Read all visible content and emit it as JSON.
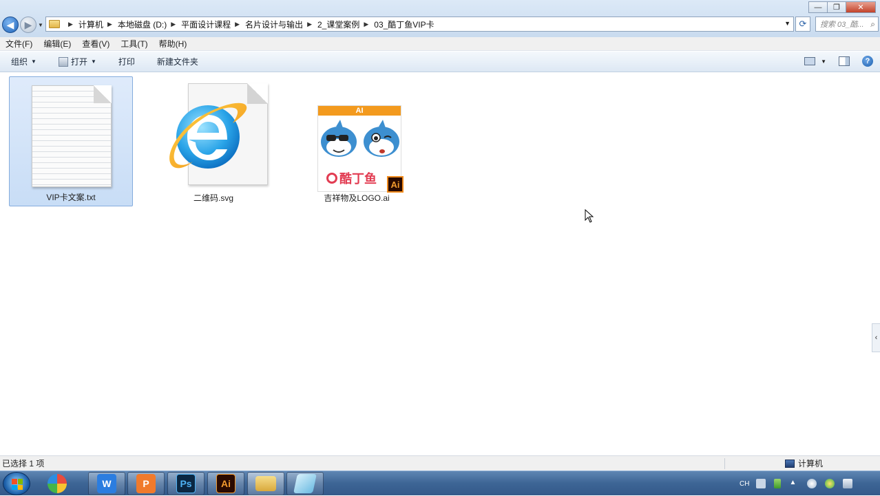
{
  "window": {
    "controls": {
      "minimize": "—",
      "restore": "❐",
      "close": "✕"
    }
  },
  "address": {
    "crumbs": [
      "计算机",
      "本地磁盘 (D:)",
      "平面设计课程",
      "名片设计与输出",
      "2_课堂案例",
      "03_酷丁鱼VIP卡"
    ],
    "search_placeholder": "搜索 03_酷..."
  },
  "menubar": {
    "items": [
      "文件(F)",
      "编辑(E)",
      "查看(V)",
      "工具(T)",
      "帮助(H)"
    ]
  },
  "toolbar": {
    "organize": "组织",
    "open": "打开",
    "print": "打印",
    "new_folder": "新建文件夹"
  },
  "files": [
    {
      "name": "VIP卡文案.txt",
      "type": "text-document-icon",
      "selected": true
    },
    {
      "name": "二维码.svg",
      "type": "internet-explorer-icon",
      "selected": false
    },
    {
      "name": "吉祥物及LOGO.ai",
      "type": "illustrator-thumbnail",
      "selected": false,
      "thumb_header": "AI",
      "thumb_brand": "酷丁鱼",
      "badge": "Ai"
    }
  ],
  "statusbar": {
    "selection": "已选择 1 项",
    "location": "计算机"
  },
  "taskbar": {
    "apps": [
      {
        "name": "360-icon",
        "label": ""
      },
      {
        "name": "wps-writer-icon",
        "label": "W",
        "color": "#2b7de0"
      },
      {
        "name": "wps-presentation-icon",
        "label": "P",
        "color": "#f07a2c"
      },
      {
        "name": "photoshop-icon",
        "label": "Ps",
        "color": "#0b2742"
      },
      {
        "name": "illustrator-icon",
        "label": "Ai",
        "color": "#2a0a00"
      },
      {
        "name": "file-explorer-icon",
        "label": "",
        "color": "#e8c45c"
      },
      {
        "name": "notes-app-icon",
        "label": "",
        "color": "#7fc6e8"
      }
    ],
    "tray_lang": "CH"
  },
  "colors": {
    "accent": "#1f63b8",
    "selection": "#c8ddf6",
    "ai_orange": "#f39a1e",
    "brand_red": "#e23c52"
  }
}
